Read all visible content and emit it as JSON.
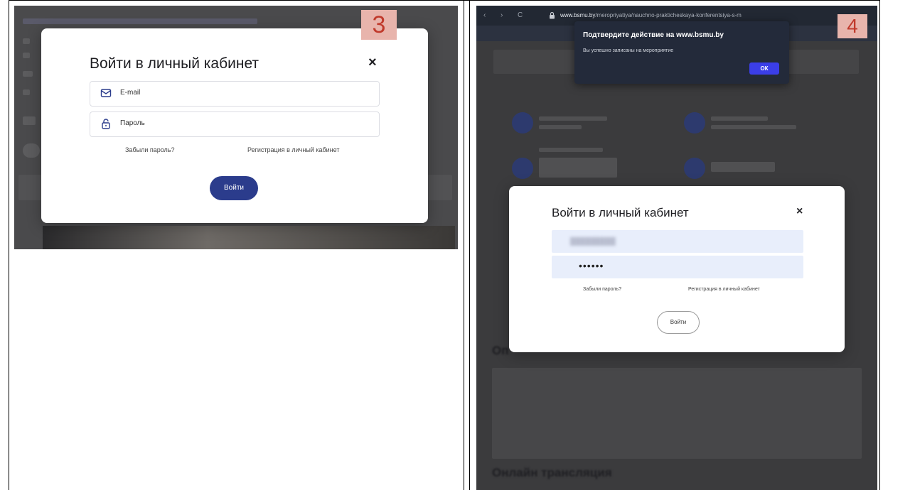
{
  "left_panel": {
    "badge": "3",
    "modal": {
      "title": "Войти в личный кабинет",
      "close": "×",
      "email_placeholder": "E-mail",
      "password_placeholder": "Пароль",
      "forgot_link": "Забыли пароль?",
      "register_link": "Регистрация в личный кабинет",
      "submit": "Войти"
    }
  },
  "right_panel": {
    "badge": "4",
    "browser": {
      "back": "‹",
      "forward": "›",
      "reload": "C",
      "url_domain": "www.bsmu.by",
      "url_path": "/meropriyatiya/nauchno-prakticheskaya-konferentsiya-s-m"
    },
    "dialog": {
      "title": "Подтвердите действие на www.bsmu.by",
      "message": "Вы успешно записаны на мероприятие",
      "ok": "ОК"
    },
    "modal": {
      "title": "Войти в личный кабинет",
      "close": "×",
      "password_value": "••••••",
      "forgot_link": "Забыли пароль?",
      "register_link": "Регистрация в личный кабинет",
      "submit": "Войти"
    },
    "background": {
      "heading_1": "Оп",
      "heading_2": "Онлайн трансляция"
    }
  },
  "colors": {
    "primary_button": "#2b3c8c",
    "dialog_ok": "#3b3ee8",
    "badge_bg": "#e8b4ac",
    "badge_text": "#c0392b",
    "overlay": "#3b3b3d"
  },
  "icons": [
    "envelope-icon",
    "lock-icon",
    "close-icon",
    "padlock-icon"
  ]
}
